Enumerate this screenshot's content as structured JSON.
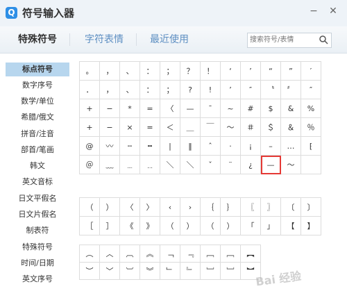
{
  "window": {
    "title": "符号输入器",
    "logo_text": "Q",
    "minimize_glyph": "−",
    "close_glyph": "✕"
  },
  "tabs": [
    {
      "label": "特殊符号"
    },
    {
      "label": "字符表情"
    },
    {
      "label": "最近使用"
    }
  ],
  "search": {
    "placeholder": "搜索符号/表情",
    "value": ""
  },
  "sidebar": {
    "items": [
      {
        "label": "标点符号"
      },
      {
        "label": "数字序号"
      },
      {
        "label": "数学/单位"
      },
      {
        "label": "希腊/俄文"
      },
      {
        "label": "拼音/注音"
      },
      {
        "label": "部首/笔画"
      },
      {
        "label": "韩文"
      },
      {
        "label": "英文音标"
      },
      {
        "label": "日文平假名"
      },
      {
        "label": "日文片假名"
      },
      {
        "label": "制表符"
      },
      {
        "label": "特殊符号"
      },
      {
        "label": "时间/日期"
      },
      {
        "label": "英文序号"
      }
    ]
  },
  "grid1": [
    [
      "。",
      "，",
      "、",
      "：",
      "；",
      "？",
      "！",
      "‘",
      "’",
      "“",
      "”",
      "′"
    ],
    [
      "．",
      "，",
      "、",
      "：",
      "；",
      "?",
      "!",
      "ʼ",
      "″",
      "〝",
      "〞",
      "″"
    ],
    [
      "+",
      "−",
      "*",
      "=",
      "〈",
      "—",
      "¯",
      "~",
      "#",
      "$",
      "&",
      "%"
    ],
    [
      "+",
      "−",
      "×",
      "=",
      "＜",
      "＿",
      "￣",
      "～",
      "＃",
      "＄",
      "＆",
      "％"
    ],
    [
      "@",
      "〰",
      "╌",
      "╍",
      "|",
      "‖",
      "ˆ",
      "·",
      "¡",
      "–",
      "…",
      "⁅"
    ],
    [
      "＠",
      "﹏",
      "﹍",
      "﹎",
      "＼",
      "＼",
      "ˇ",
      "¨",
      "¿",
      "—",
      "～",
      ""
    ]
  ],
  "grid2": [
    [
      "（",
      "）",
      "〈",
      "〉",
      "‹",
      "›",
      "｛",
      "｝",
      "〖",
      "〗",
      "〔",
      "〕"
    ],
    [
      "［",
      "］",
      "《",
      "》",
      "（",
      "）",
      "（",
      "）",
      "「",
      "」",
      "【",
      "】"
    ]
  ],
  "grid3": [
    [
      "︵",
      "︿",
      "︹",
      "︽",
      "﹁",
      "﹃",
      "﹇",
      "﹇",
      "︻"
    ],
    [
      "︶",
      "﹀",
      "︺",
      "︾",
      "﹂",
      "﹄",
      "﹈",
      "﹈",
      "︼"
    ]
  ],
  "selected_symbol": "—",
  "watermark": "Bai 经验"
}
